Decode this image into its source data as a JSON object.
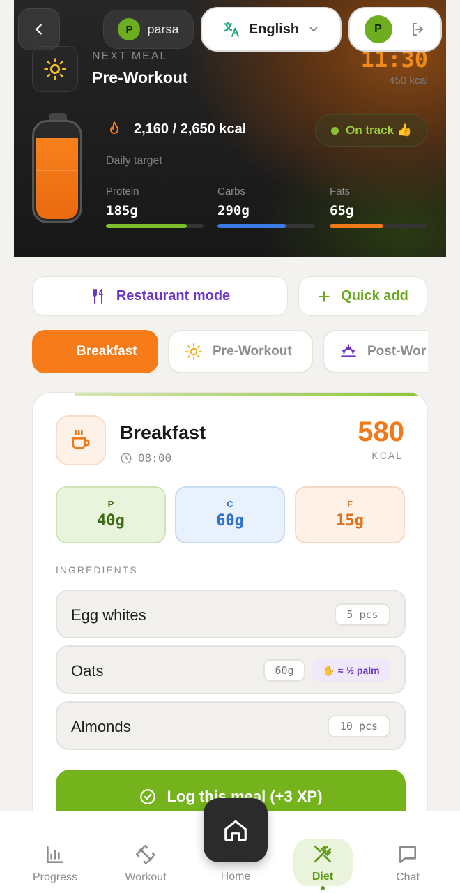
{
  "header": {
    "user_name": "parsa",
    "user_initial": "P",
    "language": "English",
    "account_initial": "P"
  },
  "next_meal": {
    "label": "NEXT MEAL",
    "title": "Pre-Workout",
    "time": "11:30",
    "kcal": "450 kcal"
  },
  "daily": {
    "calories_text": "2,160 / 2,650 kcal",
    "calories_consumed": 2160,
    "calories_target": 2650,
    "target_label": "Daily target",
    "status": "On track 👍",
    "macros": [
      {
        "label": "Protein",
        "value": "185g",
        "progress": 0.83,
        "color": "#7cbf2a"
      },
      {
        "label": "Carbs",
        "value": "290g",
        "progress": 0.7,
        "color": "#3b7be6"
      },
      {
        "label": "Fats",
        "value": "65g",
        "progress": 0.55,
        "color": "#f07a1a"
      }
    ]
  },
  "actions": {
    "restaurant_mode": "Restaurant mode",
    "quick_add": "Quick add"
  },
  "tabs": [
    {
      "label": "Breakfast",
      "icon": "coffee-icon",
      "active": true
    },
    {
      "label": "Pre-Workout",
      "icon": "sun-icon",
      "active": false
    },
    {
      "label": "Post-Wor",
      "icon": "sunset-icon",
      "active": false
    }
  ],
  "meal": {
    "name": "Breakfast",
    "time": "08:00",
    "kcal": "580",
    "kcal_unit": "KCAL",
    "macros": {
      "p_label": "P",
      "p_value": "40g",
      "c_label": "C",
      "c_value": "60g",
      "f_label": "F",
      "f_value": "15g"
    },
    "ingredients_label": "INGREDIENTS",
    "ingredients": [
      {
        "name": "Egg whites",
        "qty": "5 pcs"
      },
      {
        "name": "Oats",
        "qty": "60g",
        "hint": "≈ ½ palm"
      },
      {
        "name": "Almonds",
        "qty": "10 pcs"
      }
    ],
    "log_button": "Log this meal (+3 XP)"
  },
  "nav": {
    "progress": "Progress",
    "workout": "Workout",
    "home": "Home",
    "diet": "Diet",
    "chat": "Chat",
    "active": "Diet"
  },
  "colors": {
    "accent_orange": "#f77b18",
    "accent_green": "#74b31c",
    "accent_purple": "#6b36c7"
  }
}
